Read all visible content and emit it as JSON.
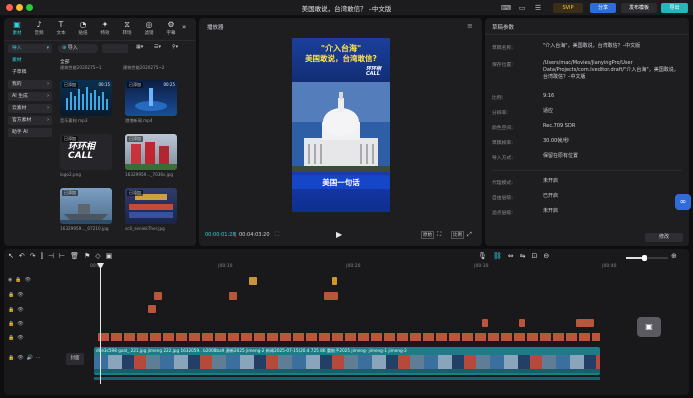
{
  "window": {
    "title": "美国敢说，台湾敢信？ –中文版",
    "svip_label": "SVIP",
    "share_label": "分享",
    "publish_template_label": "发布模板",
    "export_label": "导出"
  },
  "toolbar": {
    "items": [
      "素材",
      "音频",
      "文本",
      "贴纸",
      "特效",
      "转场",
      "滤镜",
      "调节",
      "字幕",
      "数"
    ]
  },
  "left_nav": {
    "import": "导入",
    "material": "素材",
    "subtitle": "子草稿",
    "mine": "我的",
    "ai_gen": "AI 生成",
    "cloud": "云素材",
    "official": "官方素材",
    "team": "团队素材",
    "tutor": "助手 AI"
  },
  "media": {
    "import_btn": "导入",
    "all_label": "全部",
    "items": [
      {
        "badge": "",
        "duration": "",
        "caption": "建筑性能2020275~1"
      },
      {
        "badge": "",
        "duration": "",
        "caption": "建筑性能2020275~2"
      },
      {
        "badge": "已添加",
        "duration": "00:15",
        "caption": "音乐素材.mp3"
      },
      {
        "badge": "已添加",
        "duration": "00:25",
        "caption": "港港新闻.mp4"
      },
      {
        "badge": "已添加",
        "duration": "",
        "caption": "logo2.png"
      },
      {
        "badge": "已添加",
        "duration": "",
        "caption": "16329959..._7036s.jpg"
      },
      {
        "badge": "已添加",
        "duration": "",
        "caption": "16329959..._07210.jpg"
      },
      {
        "badge": "已添加",
        "duration": "",
        "caption": "sc0_seniekTher.jpg"
      }
    ],
    "logo_text": "环环相\nCALL"
  },
  "player": {
    "title": "播放器",
    "current_time": "00:00:01:28",
    "total_time": "00:04:03:20",
    "poster_title_1": "\"介入台海\"",
    "poster_title_2": "美国敢说，台湾敢信?",
    "poster_logo": "环环相\nCALL",
    "poster_bottom": "美国一句话",
    "btn_full": "原始",
    "btn_ratio": "比例"
  },
  "draft": {
    "title": "草稿参数",
    "rows": [
      {
        "label": "草稿名称:",
        "value": "\"介入台海\"，美国敢说，台湾敢信？–中文版"
      },
      {
        "label": "保存位置:",
        "value": "/Users/mac/Movies/JianyingPro/User Data/Projects/com.lveditor.draft/\"介入台海\"，美国敢说，台湾敢信？–中文版"
      },
      {
        "label": "比例:",
        "value": "9:16"
      },
      {
        "label": "分辨率:",
        "value": "适应"
      },
      {
        "label": "颜色空间:",
        "value": "Rec.709 SDR"
      },
      {
        "label": "草稿帧率:",
        "value": "30.00帧/秒"
      },
      {
        "label": "导入方式:",
        "value": "保留在原有位置"
      },
      {
        "label": "代理模式:",
        "value": "未开启"
      },
      {
        "label": "自由层级:",
        "value": "已开启"
      },
      {
        "label": "滤点层级:",
        "value": "未开启"
      }
    ],
    "edit_btn": "修改"
  },
  "timeline": {
    "ruler": [
      "00:00",
      "|00:10",
      "|00:20",
      "|00:30",
      "|00:40",
      "|00:50",
      "|01:00"
    ],
    "cover_label": "封面",
    "video_strip_text": "d0e3c598  goal_  221.jpg  jimeng  222.jpg  1632059..  b2008ba9  源新2025  jimeng-2  新闻2025-07-15(20.4  725  8K  重航平2025  jimeng-  jimeng-1  jimeng-2"
  },
  "colors": {
    "accent": "#2fd5d9",
    "red": "#d93636",
    "blue_btn": "#2f6bdc",
    "video_track": "#1e7c86",
    "clip_orange": "#b8563b"
  }
}
